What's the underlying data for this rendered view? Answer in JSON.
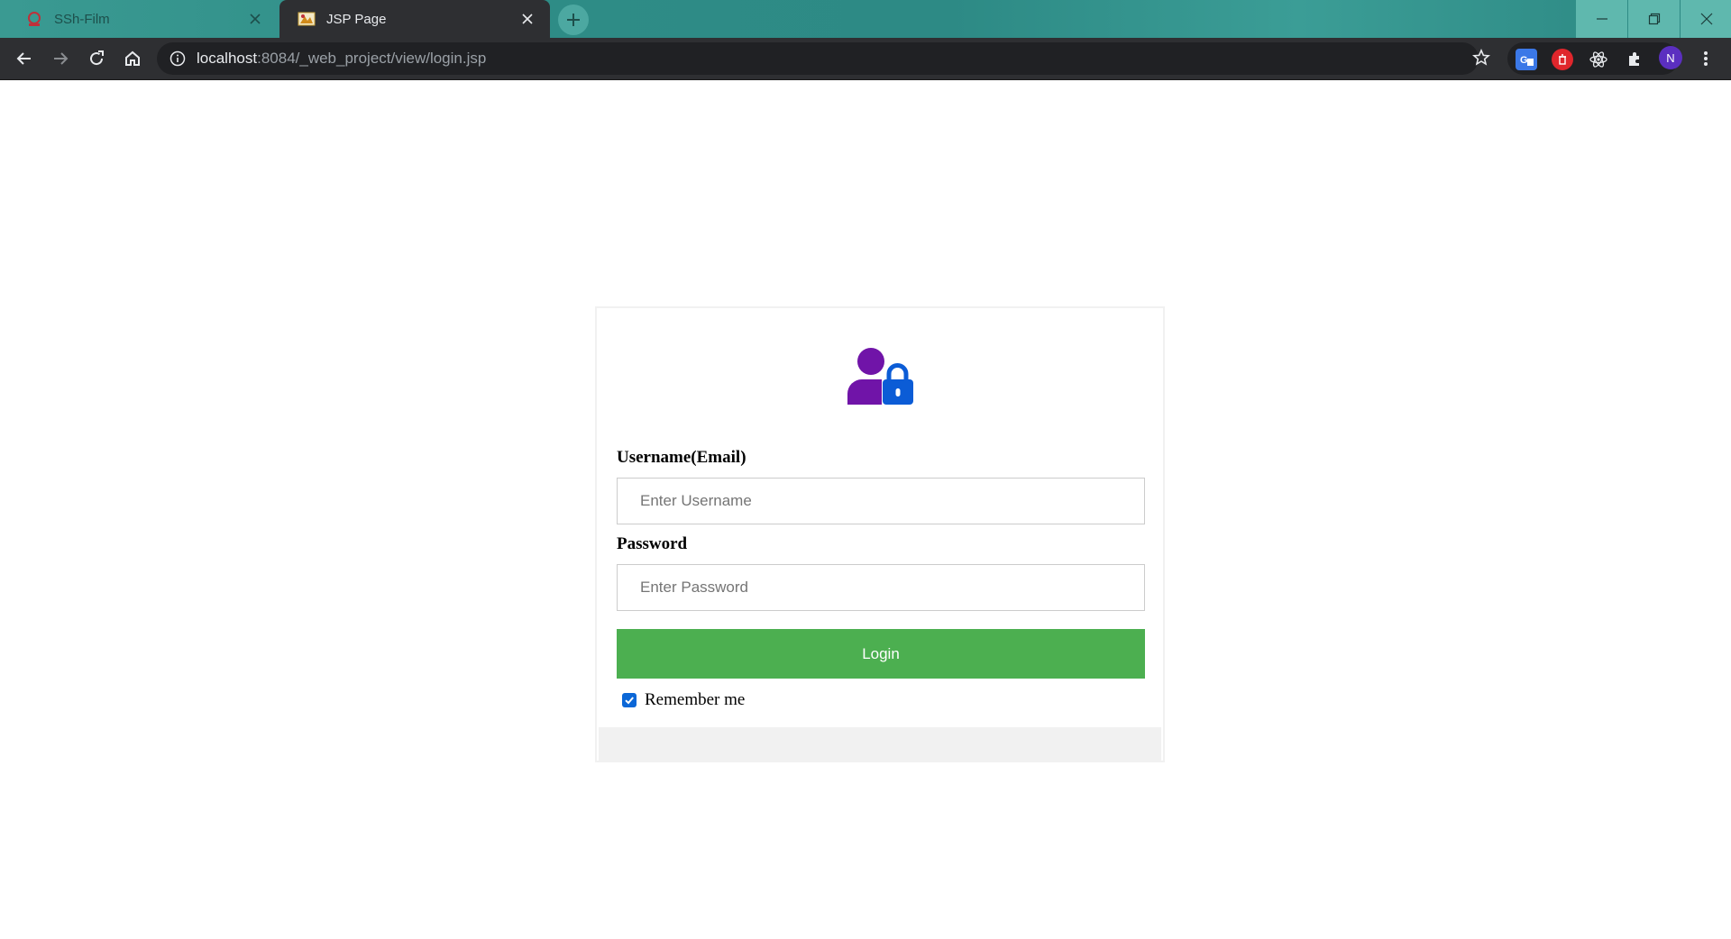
{
  "browser": {
    "tabs": [
      {
        "title": "SSh-Film",
        "active": false
      },
      {
        "title": "JSP Page",
        "active": true
      }
    ],
    "address": {
      "host": "localhost",
      "rest": ":8084/_web_project/view/login.jsp"
    },
    "profile_initial": "N",
    "colors": {
      "tabstrip": "#2e8c86",
      "toolbar": "#2e2f32",
      "omnibox": "#202124",
      "profile": "#5b2fc0"
    }
  },
  "login": {
    "username_label": "Username(Email)",
    "username_placeholder": "Enter Username",
    "username_value": "",
    "password_label": "Password",
    "password_placeholder": "Enter Password",
    "password_value": "",
    "login_button": "Login",
    "remember_label": "Remember me",
    "remember_checked": true,
    "colors": {
      "login_button": "#4caf50",
      "icon_person": "#7014a8",
      "icon_lock": "#0b5cd6",
      "checkbox": "#0b67d7",
      "footer": "#f1f1f1"
    },
    "icons": [
      "user-lock-icon"
    ]
  }
}
